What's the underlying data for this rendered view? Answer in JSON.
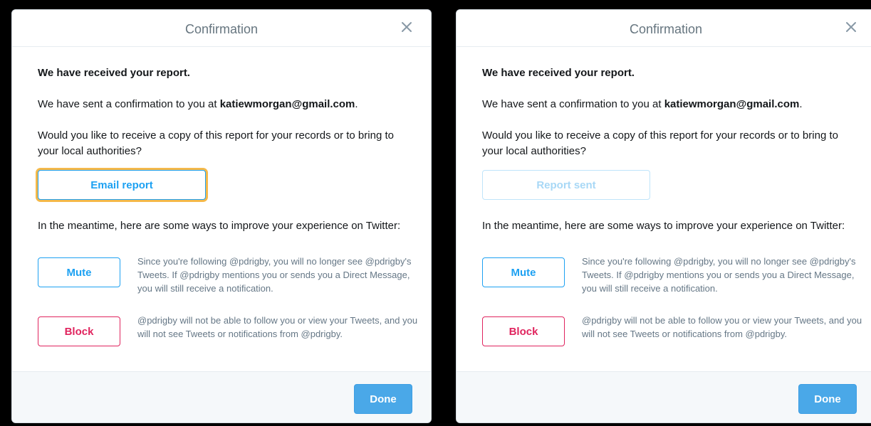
{
  "icons": {
    "close": "close-x-icon"
  },
  "colors": {
    "accent": "#1da1f2",
    "danger": "#e0245e",
    "focus_ring": "#f5b94a",
    "done_button": "#4aa8e8"
  },
  "dialogs": [
    {
      "title": "Confirmation",
      "heading": "We have received your report.",
      "sent_prefix": "We have sent a confirmation to you at",
      "email": "katiewmorgan@gmail.com",
      "sent_suffix": ".",
      "question": "Would you like to receive a copy of this report for your records or to bring to your local authorities?",
      "report_button_label": "Email report",
      "report_button_state": "focused",
      "meantime": "In the meantime, here are some ways to improve your experience on Twitter:",
      "mute_label": "Mute",
      "mute_desc": "Since you're following @pdrigby, you will no longer see @pdrigby's Tweets. If @pdrigby mentions you or sends you a Direct Message, you will still receive a notification.",
      "block_label": "Block",
      "block_desc": "@pdrigby will not be able to follow you or view your Tweets, and you will not see Tweets or notifications from @pdrigby.",
      "done_label": "Done"
    },
    {
      "title": "Confirmation",
      "heading": "We have received your report.",
      "sent_prefix": "We have sent a confirmation to you at",
      "email": "katiewmorgan@gmail.com",
      "sent_suffix": ".",
      "question": "Would you like to receive a copy of this report for your records or to bring to your local authorities?",
      "report_button_label": "Report sent",
      "report_button_state": "disabled",
      "meantime": "In the meantime, here are some ways to improve your experience on Twitter:",
      "mute_label": "Mute",
      "mute_desc": "Since you're following @pdrigby, you will no longer see @pdrigby's Tweets. If @pdrigby mentions you or sends you a Direct Message, you will still receive a notification.",
      "block_label": "Block",
      "block_desc": "@pdrigby will not be able to follow you or view your Tweets, and you will not see Tweets or notifications from @pdrigby.",
      "done_label": "Done"
    }
  ]
}
